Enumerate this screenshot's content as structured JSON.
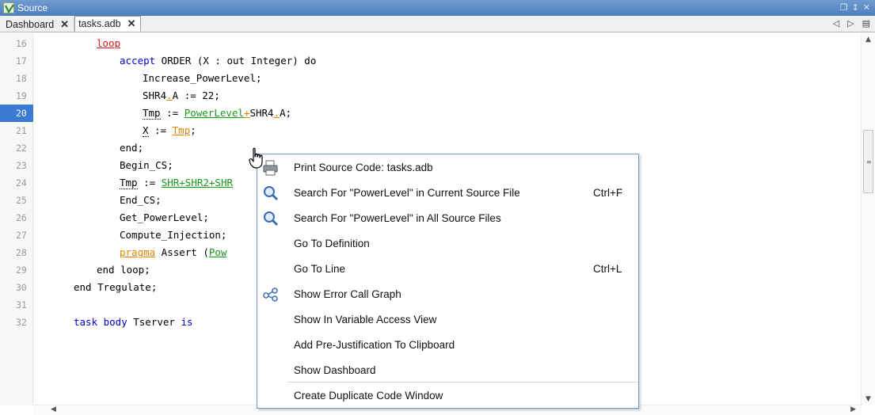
{
  "window": {
    "title": "Source",
    "controls": [
      "❐",
      "↕",
      "✕"
    ]
  },
  "tabs": [
    {
      "label": "Dashboard",
      "close": "✕",
      "active": false
    },
    {
      "label": "tasks.adb",
      "close": "✕",
      "active": true
    }
  ],
  "tab_nav": {
    "prev": "◁",
    "next": "▷",
    "list": "▤"
  },
  "editor": {
    "current_line": 20,
    "line_numbers": [
      "16",
      "17",
      "18",
      "19",
      "20",
      "21",
      "22",
      "23",
      "24",
      "25",
      "26",
      "27",
      "28",
      "29",
      "30",
      "31",
      "32"
    ],
    "code": {
      "l16_loop": "loop",
      "l17_accept": "accept",
      "l17_rest": " ORDER (X : out Integer) do",
      "l18": "Increase_PowerLevel;",
      "l19_pre": "SHR4",
      "l19_dot": ".",
      "l19_post": "A := 22;",
      "l20_tmp": "Tmp",
      "l20_assign": " := ",
      "l20_power": "PowerLevel",
      "l20_plus": "+",
      "l20_shr": "SHR4",
      "l20_dot": ".",
      "l20_post": "A;",
      "l21_x": "X",
      "l21_assign": " := ",
      "l21_tmp": "Tmp",
      "l21_semi": ";",
      "l22": "end;",
      "l23": "Begin_CS;",
      "l24_tmp": "Tmp",
      "l24_assign": " := ",
      "l24_shr": "SHR+SHR2+SHR",
      "l25": "End_CS;",
      "l26": "Get_PowerLevel;",
      "l27": "Compute_Injection;",
      "l28_pragma": "pragma",
      "l28_rest": " Assert (",
      "l28_pow": "Pow",
      "l29": "end loop;",
      "l30": "end Tregulate;",
      "l32_task": "task body",
      "l32_rest": " Tserver ",
      "l32_is": "is"
    }
  },
  "context_menu": {
    "items": [
      {
        "label": "Print Source Code: tasks.adb",
        "shortcut": "",
        "icon": "printer-icon"
      },
      {
        "label": "Search For \"PowerLevel\" in Current Source File",
        "shortcut": "Ctrl+F",
        "icon": "magnifier-icon"
      },
      {
        "label": "Search For \"PowerLevel\" in All Source Files",
        "shortcut": "",
        "icon": "magnifier-icon"
      },
      {
        "label": "Go To Definition",
        "shortcut": "",
        "icon": ""
      },
      {
        "label": "Go To Line",
        "shortcut": "Ctrl+L",
        "icon": ""
      },
      {
        "label": "Show Error Call Graph",
        "shortcut": "",
        "icon": "call-graph-icon"
      },
      {
        "label": "Show In Variable Access View",
        "shortcut": "",
        "icon": ""
      },
      {
        "label": "Add Pre-Justification To Clipboard",
        "shortcut": "",
        "icon": ""
      },
      {
        "label": "Show Dashboard",
        "shortcut": "",
        "icon": ""
      },
      {
        "label": "Create Duplicate Code Window",
        "shortcut": "",
        "icon": ""
      }
    ]
  },
  "colors": {
    "title_bar": "#5a8ac6",
    "current_line": "#3a7bd5",
    "keyword": "#0000cc",
    "green_token": "#1a9a1a",
    "orange_token": "#e08000",
    "red_keyword": "#e01010",
    "menu_border": "#6f9bd8"
  }
}
